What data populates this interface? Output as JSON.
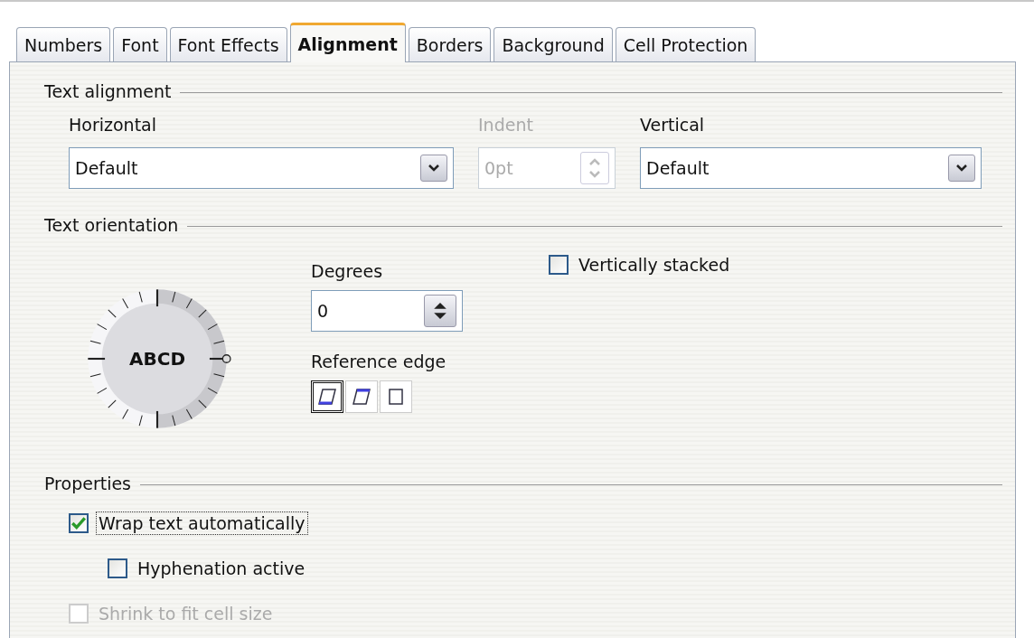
{
  "tabs": [
    {
      "label": "Numbers",
      "selected": false
    },
    {
      "label": "Font",
      "selected": false
    },
    {
      "label": "Font Effects",
      "selected": false
    },
    {
      "label": "Alignment",
      "selected": true
    },
    {
      "label": "Borders",
      "selected": false
    },
    {
      "label": "Background",
      "selected": false
    },
    {
      "label": "Cell Protection",
      "selected": false
    }
  ],
  "text_alignment": {
    "title": "Text alignment",
    "horizontal": {
      "label": "Horizontal",
      "value": "Default"
    },
    "indent": {
      "label": "Indent",
      "value": "0pt",
      "disabled": true
    },
    "vertical": {
      "label": "Vertical",
      "value": "Default"
    }
  },
  "text_orientation": {
    "title": "Text orientation",
    "dial_text": "ABCD",
    "degrees": {
      "label": "Degrees",
      "value": "0"
    },
    "reference_edge": {
      "label": "Reference edge",
      "options": [
        {
          "kind": "bottom",
          "selected": true
        },
        {
          "kind": "top",
          "selected": false
        },
        {
          "kind": "cell",
          "selected": false
        }
      ]
    },
    "vertically_stacked": {
      "label": "Vertically stacked",
      "checked": false
    }
  },
  "properties": {
    "title": "Properties",
    "options": [
      {
        "label": "Wrap text automatically",
        "checked": true,
        "disabled": false,
        "focused": true,
        "children": [
          {
            "label": "Hyphenation active",
            "checked": false,
            "disabled": false,
            "focused": false
          }
        ]
      },
      {
        "label": "Shrink to fit cell size",
        "checked": false,
        "disabled": true,
        "focused": false
      }
    ]
  }
}
